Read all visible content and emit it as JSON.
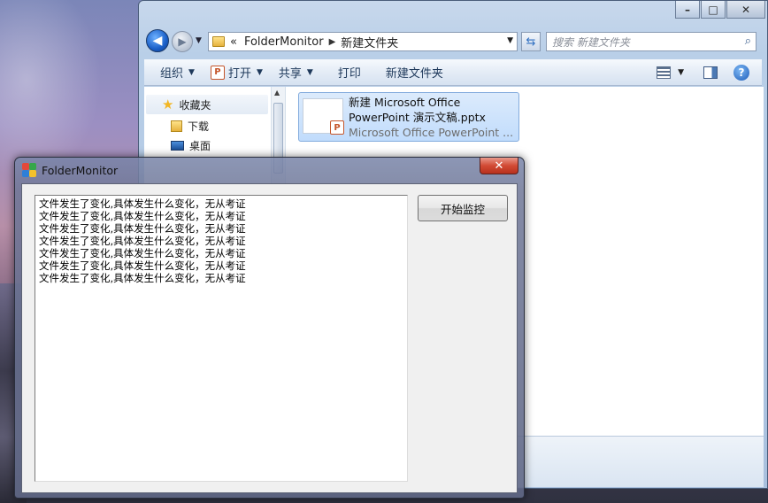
{
  "explorer": {
    "address": {
      "prefix": "«",
      "crumbs": [
        "FolderMonitor",
        "新建文件夹"
      ],
      "separator": "▶"
    },
    "search_placeholder": "搜索 新建文件夹",
    "commands": {
      "organize": "组织",
      "open": "打开",
      "share": "共享",
      "print": "打印",
      "new_folder": "新建文件夹"
    },
    "nav": {
      "favorites": "收藏夹",
      "downloads": "下载",
      "desktop": "桌面"
    },
    "file": {
      "name_line1": "新建 Microsoft Office",
      "name_line2": "PowerPoint 演示文稿.pptx",
      "type": "Microsoft Office PowerPoint ..."
    },
    "caption": {
      "minimize": "–",
      "maximize": "□",
      "close": "✕"
    }
  },
  "monitor": {
    "title": "FolderMonitor",
    "close": "✕",
    "start_button": "开始监控",
    "log": [
      "文件发生了变化,具体发生什么变化，无从考证",
      "文件发生了变化,具体发生什么变化，无从考证",
      "文件发生了变化,具体发生什么变化，无从考证",
      "文件发生了变化,具体发生什么变化，无从考证",
      "文件发生了变化,具体发生什么变化，无从考证",
      "文件发生了变化,具体发生什么变化，无从考证",
      "文件发生了变化,具体发生什么变化，无从考证"
    ]
  }
}
